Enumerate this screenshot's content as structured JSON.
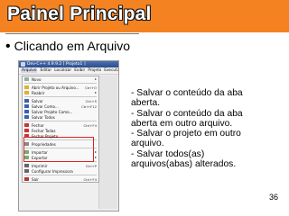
{
  "slide": {
    "title": "Painel Principal",
    "bullet": "Clicando em Arquivo",
    "notes": [
      "- Salvar o conteúdo da aba",
      "aberta.",
      "- Salvar o conteúdo da aba",
      "aberta em outro arquivo.",
      "- Salvar o projeto em outro",
      "arquivo.",
      "- Salvar todos(as)",
      "arquivos(abas) alterados."
    ],
    "page_number": "36"
  },
  "colors": {
    "header_band": "#f58220",
    "highlight_box": "#dd2222"
  },
  "ide": {
    "window_title": "Dev-C++ 4.9.9.2   [ Projeto1 ]",
    "menubar": [
      "Arquivo",
      "Editar",
      "Localizar",
      "Exibir",
      "Projeto",
      "Executar"
    ],
    "file_menu": [
      {
        "label": "Novo",
        "shortcut": "",
        "submenu": true,
        "icon": "new-icon"
      },
      {
        "sep": true
      },
      {
        "label": "Abrir Projeto ou Arquivo...",
        "shortcut": "Ctrl+O",
        "icon": "open-icon"
      },
      {
        "label": "Reabrir",
        "shortcut": "",
        "submenu": true,
        "icon": "reopen-icon"
      },
      {
        "sep": true
      },
      {
        "label": "Salvar",
        "shortcut": "Ctrl+S",
        "icon": "save-icon"
      },
      {
        "label": "Salvar Como...",
        "shortcut": "Ctrl+F12",
        "icon": "save-as-icon"
      },
      {
        "label": "Salvar Projeto Como...",
        "shortcut": "",
        "icon": "save-project-icon"
      },
      {
        "label": "Salvar Todos",
        "shortcut": "",
        "icon": "save-all-icon"
      },
      {
        "sep": true
      },
      {
        "label": "Fechar",
        "shortcut": "Ctrl+F4",
        "icon": "close-icon"
      },
      {
        "label": "Fechar Todas",
        "shortcut": "",
        "icon": "close-all-icon"
      },
      {
        "label": "Fechar Projeto",
        "shortcut": "",
        "icon": "close-project-icon"
      },
      {
        "sep": true
      },
      {
        "label": "Propriedades",
        "shortcut": "",
        "icon": "properties-icon"
      },
      {
        "sep": true
      },
      {
        "label": "Importar",
        "shortcut": "",
        "submenu": true,
        "icon": "import-icon"
      },
      {
        "label": "Exportar",
        "shortcut": "",
        "submenu": true,
        "icon": "export-icon"
      },
      {
        "sep": true
      },
      {
        "label": "Imprimir",
        "shortcut": "Ctrl+P",
        "icon": "print-icon"
      },
      {
        "label": "Configurar Impressora",
        "shortcut": "",
        "icon": "printer-setup-icon"
      },
      {
        "sep": true
      },
      {
        "label": "Sair",
        "shortcut": "Ctrl+F4",
        "icon": "exit-icon"
      }
    ]
  }
}
